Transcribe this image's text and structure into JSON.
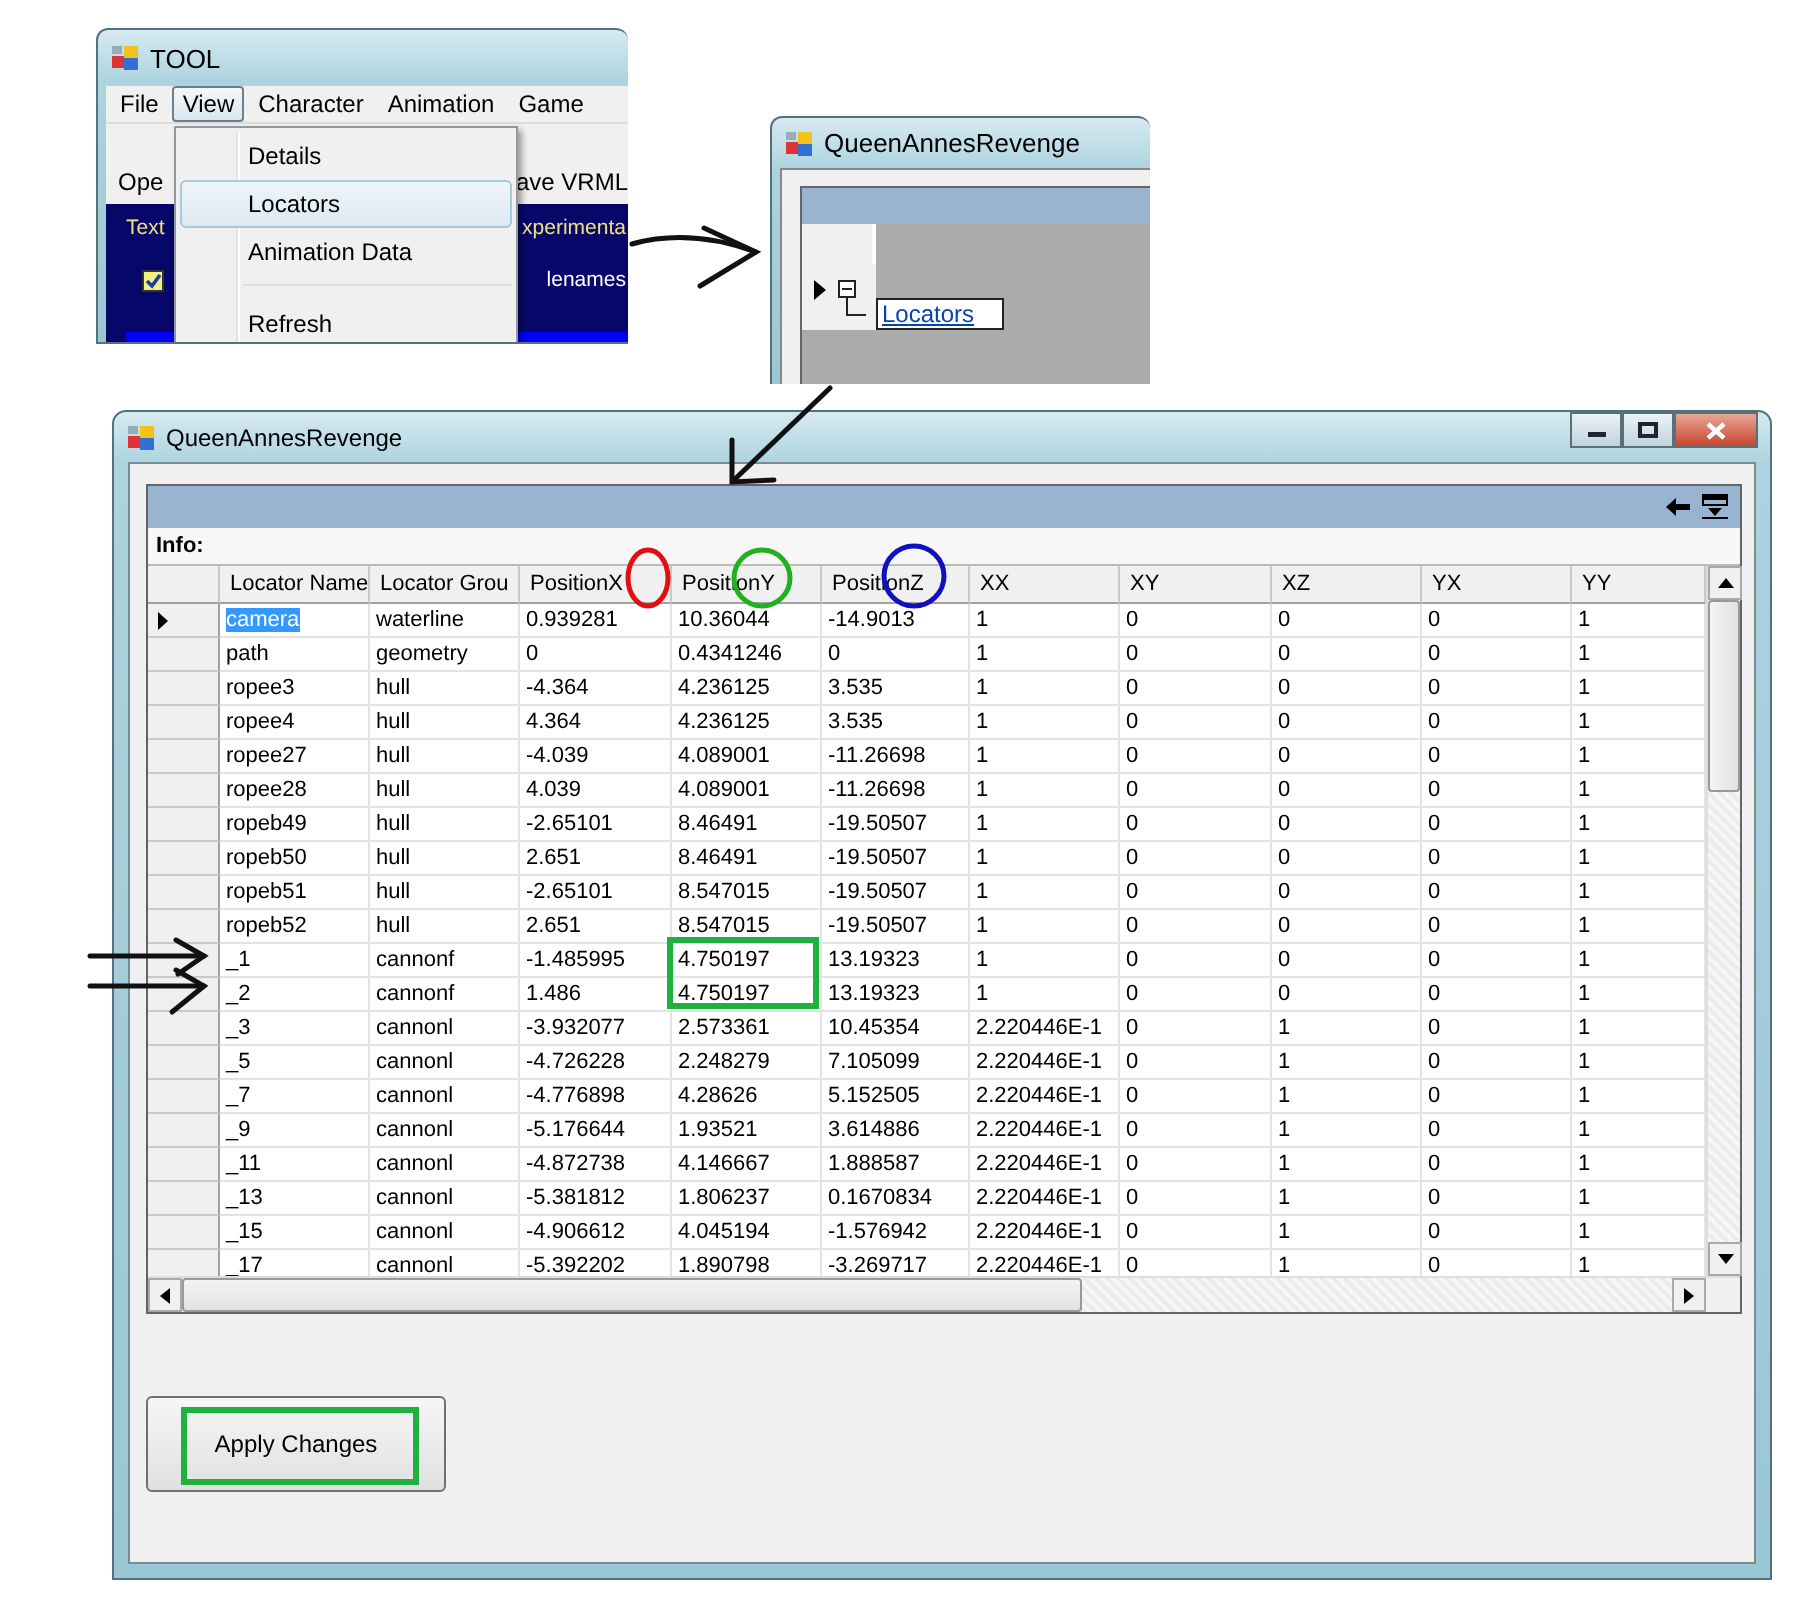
{
  "tool_window": {
    "title": "TOOL",
    "menu": [
      {
        "label": "File",
        "selected": false
      },
      {
        "label": "View",
        "selected": true
      },
      {
        "label": "Character",
        "selected": false
      },
      {
        "label": "Animation",
        "selected": false
      },
      {
        "label": "Game",
        "selected": false
      }
    ],
    "dropdown": [
      {
        "kind": "item",
        "label": "Details",
        "selected": false
      },
      {
        "kind": "item",
        "label": "Locators",
        "selected": true
      },
      {
        "kind": "item",
        "label": "Animation Data",
        "selected": false
      },
      {
        "kind": "separator"
      },
      {
        "kind": "item",
        "label": "Refresh",
        "selected": false
      }
    ],
    "toolbar": [
      "Ope",
      "ave VRML"
    ],
    "panel_texts": [
      "Text",
      "xperimenta"
    ],
    "checkbox": {
      "checked": true
    },
    "checkbox_label": "lenames"
  },
  "tree_window": {
    "title": "QueenAnnesRevenge",
    "rows": [
      {
        "selected": true,
        "expanded": true,
        "label": "Locators"
      }
    ]
  },
  "grid_window": {
    "title": "QueenAnnesRevenge",
    "info_label": "Info:",
    "columns": [
      "Locator Name",
      "Locator Grou",
      "PositionX",
      "PositionY",
      "PositionZ",
      "XX",
      "XY",
      "XZ",
      "YX",
      "YY"
    ],
    "rows": [
      {
        "selected": true,
        "cells": [
          "camera",
          "waterline",
          "0.939281",
          "10.36044",
          "-14.9013",
          "1",
          "0",
          "0",
          "0",
          "1"
        ]
      },
      {
        "selected": false,
        "cells": [
          "path",
          "geometry",
          "0",
          "0.4341246",
          "0",
          "1",
          "0",
          "0",
          "0",
          "1"
        ]
      },
      {
        "selected": false,
        "cells": [
          "ropee3",
          "hull",
          "-4.364",
          "4.236125",
          "3.535",
          "1",
          "0",
          "0",
          "0",
          "1"
        ]
      },
      {
        "selected": false,
        "cells": [
          "ropee4",
          "hull",
          "4.364",
          "4.236125",
          "3.535",
          "1",
          "0",
          "0",
          "0",
          "1"
        ]
      },
      {
        "selected": false,
        "cells": [
          "ropee27",
          "hull",
          "-4.039",
          "4.089001",
          "-11.26698",
          "1",
          "0",
          "0",
          "0",
          "1"
        ]
      },
      {
        "selected": false,
        "cells": [
          "ropee28",
          "hull",
          "4.039",
          "4.089001",
          "-11.26698",
          "1",
          "0",
          "0",
          "0",
          "1"
        ]
      },
      {
        "selected": false,
        "cells": [
          "ropeb49",
          "hull",
          "-2.65101",
          "8.46491",
          "-19.50507",
          "1",
          "0",
          "0",
          "0",
          "1"
        ]
      },
      {
        "selected": false,
        "cells": [
          "ropeb50",
          "hull",
          "2.651",
          "8.46491",
          "-19.50507",
          "1",
          "0",
          "0",
          "0",
          "1"
        ]
      },
      {
        "selected": false,
        "cells": [
          "ropeb51",
          "hull",
          "-2.65101",
          "8.547015",
          "-19.50507",
          "1",
          "0",
          "0",
          "0",
          "1"
        ]
      },
      {
        "selected": false,
        "cells": [
          "ropeb52",
          "hull",
          "2.651",
          "8.547015",
          "-19.50507",
          "1",
          "0",
          "0",
          "0",
          "1"
        ]
      },
      {
        "selected": false,
        "cells": [
          "_1",
          "cannonf",
          "-1.485995",
          "4.750197",
          "13.19323",
          "1",
          "0",
          "0",
          "0",
          "1"
        ]
      },
      {
        "selected": false,
        "cells": [
          "_2",
          "cannonf",
          "1.486",
          "4.750197",
          "13.19323",
          "1",
          "0",
          "0",
          "0",
          "1"
        ]
      },
      {
        "selected": false,
        "cells": [
          "_3",
          "cannonl",
          "-3.932077",
          "2.573361",
          "10.45354",
          "2.220446E-1",
          "0",
          "1",
          "0",
          "1"
        ]
      },
      {
        "selected": false,
        "cells": [
          "_5",
          "cannonl",
          "-4.726228",
          "2.248279",
          "7.105099",
          "2.220446E-1",
          "0",
          "1",
          "0",
          "1"
        ]
      },
      {
        "selected": false,
        "cells": [
          "_7",
          "cannonl",
          "-4.776898",
          "4.28626",
          "5.152505",
          "2.220446E-1",
          "0",
          "1",
          "0",
          "1"
        ]
      },
      {
        "selected": false,
        "cells": [
          "_9",
          "cannonl",
          "-5.176644",
          "1.93521",
          "3.614886",
          "2.220446E-1",
          "0",
          "1",
          "0",
          "1"
        ]
      },
      {
        "selected": false,
        "cells": [
          "_11",
          "cannonl",
          "-4.872738",
          "4.146667",
          "1.888587",
          "2.220446E-1",
          "0",
          "1",
          "0",
          "1"
        ]
      },
      {
        "selected": false,
        "cells": [
          "_13",
          "cannonl",
          "-5.381812",
          "1.806237",
          "0.1670834",
          "2.220446E-1",
          "0",
          "1",
          "0",
          "1"
        ]
      },
      {
        "selected": false,
        "cells": [
          "_15",
          "cannonl",
          "-4.906612",
          "4.045194",
          "-1.576942",
          "2.220446E-1",
          "0",
          "1",
          "0",
          "1"
        ]
      },
      {
        "selected": false,
        "cells": [
          "_17",
          "cannonl",
          "-5.392202",
          "1.890798",
          "-3.269717",
          "2.220446E-1",
          "0",
          "1",
          "0",
          "1"
        ]
      }
    ],
    "button": "Apply Changes"
  }
}
